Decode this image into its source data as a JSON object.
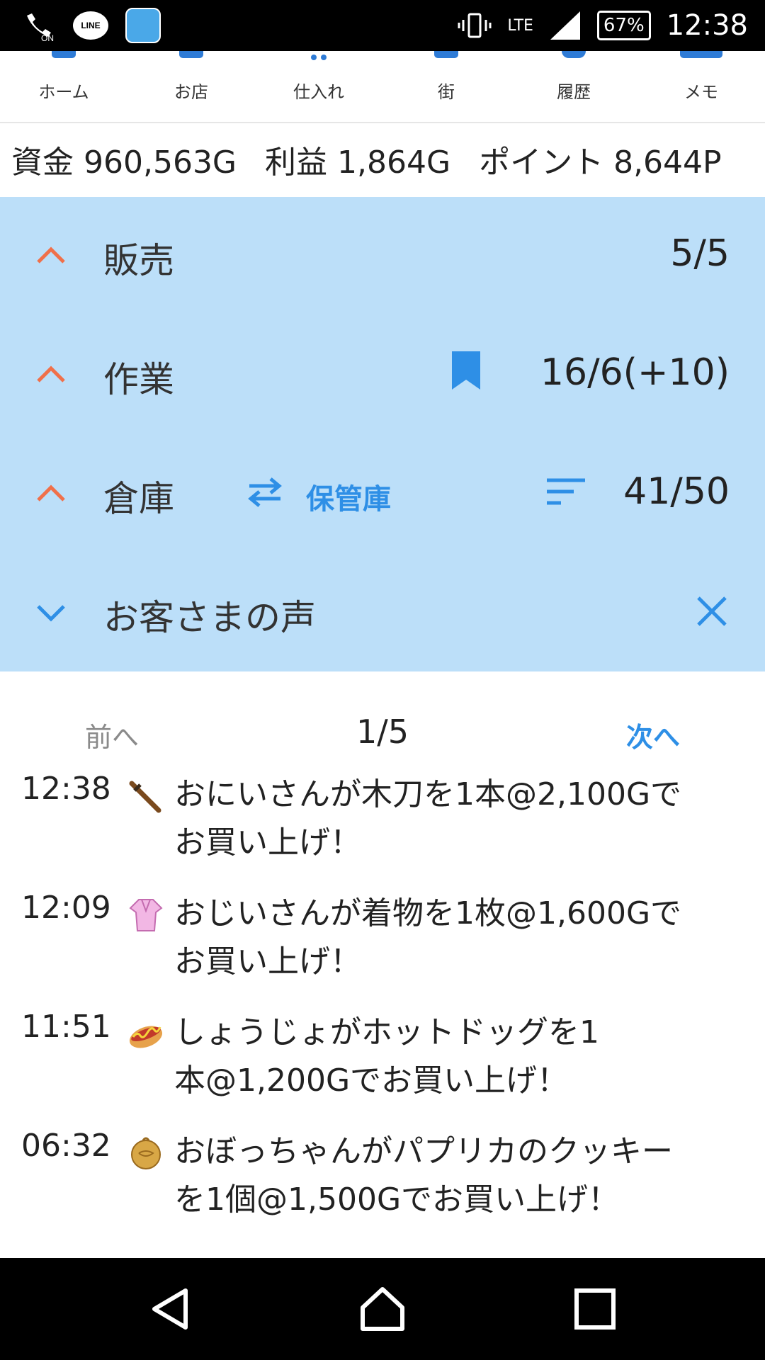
{
  "status_bar": {
    "network": "LTE",
    "battery": "67%",
    "time": "12:38",
    "left_icons": [
      "wifi-calling-on-icon",
      "line-app-icon",
      "game-app-icon"
    ],
    "right_icons": [
      "vibrate-icon",
      "signal-icon",
      "battery-icon"
    ]
  },
  "nav": {
    "items": [
      {
        "label": "ホーム"
      },
      {
        "label": "お店"
      },
      {
        "label": "仕入れ"
      },
      {
        "label": "街"
      },
      {
        "label": "履歴"
      },
      {
        "label": "メモ"
      }
    ]
  },
  "funds": {
    "capital": "資金 960,563G",
    "profit": "利益 1,864G",
    "points": "ポイント 8,644P"
  },
  "panel": {
    "sales": {
      "label": "販売",
      "value": "5/5"
    },
    "work": {
      "label": "作業",
      "value": "16/6(+10)"
    },
    "warehouse": {
      "label": "倉庫",
      "storage_label": "保管庫",
      "value": "41/50"
    },
    "voices": {
      "label": "お客さまの声"
    }
  },
  "pager": {
    "prev": "前へ",
    "page": "1/5",
    "next": "次へ"
  },
  "feed": [
    {
      "time": "12:38",
      "icon": "wooden-sword-icon",
      "line1": "おにいさんが木刀を1本@2,100Gで",
      "line2": "お買い上げ！"
    },
    {
      "time": "12:09",
      "icon": "kimono-icon",
      "line1": "おじいさんが着物を1枚@1,600Gで",
      "line2": "お買い上げ！"
    },
    {
      "time": "11:51",
      "icon": "hotdog-icon",
      "line1": "しょうじょがホットドッグを1",
      "line2": "本@1,200Gでお買い上げ！"
    },
    {
      "time": "06:32",
      "icon": "cookie-icon",
      "line1": "おぼっちゃんがパプリカのクッキー",
      "line2": "を1個@1,500Gでお買い上げ！"
    }
  ],
  "colors": {
    "panel_bg": "#bcdff9",
    "accent_blue": "#2e8fe6",
    "chevron_up": "#f0704a",
    "nav_icon": "#2e7bd6"
  }
}
